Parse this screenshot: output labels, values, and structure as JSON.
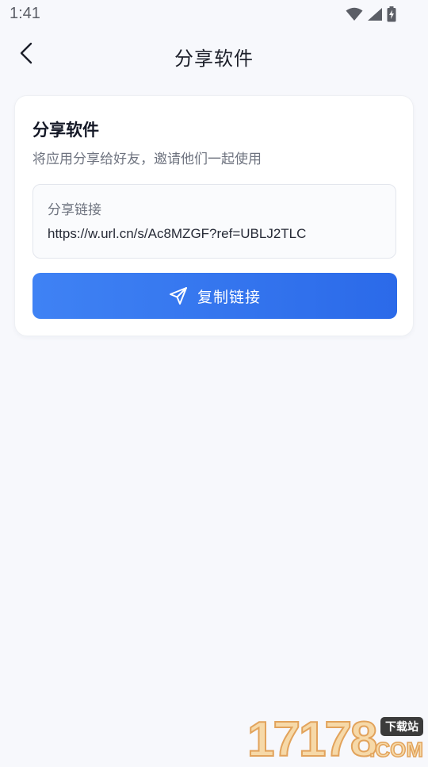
{
  "status_bar": {
    "time": "1:41",
    "icons": [
      "wifi-icon",
      "cellular-signal-icon",
      "battery-charging-icon"
    ]
  },
  "header": {
    "back_icon": "chevron-left-icon",
    "title": "分享软件"
  },
  "card": {
    "title": "分享软件",
    "subtitle": "将应用分享给好友，邀请他们一起使用",
    "link_box": {
      "label": "分享链接",
      "url": "https://w.url.cn/s/Ac8MZGF?ref=UBLJ2TLC"
    },
    "copy_button": {
      "icon": "send-icon",
      "label": "复制链接"
    }
  },
  "watermark": {
    "digits": "17178",
    "tag": "下载站",
    "suffix": ".COM"
  },
  "colors": {
    "background": "#f7f8fc",
    "card": "#ffffff",
    "accent_start": "#3f82f4",
    "accent_end": "#2b6ae9",
    "muted_text": "#6f7480"
  }
}
